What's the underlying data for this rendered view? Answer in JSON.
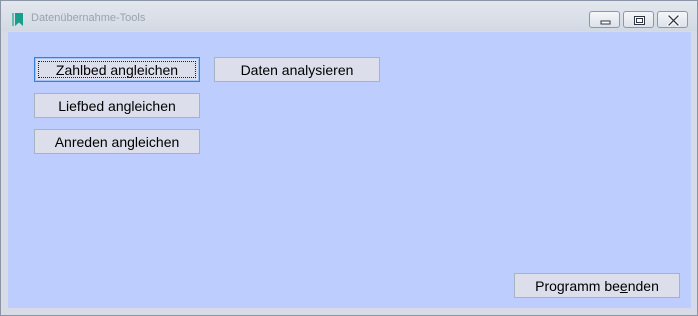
{
  "window": {
    "title": "Datenübernahme-Tools",
    "controls": {
      "minimize": "minimize-icon",
      "maximize": "maximize-icon",
      "close": "close-icon"
    }
  },
  "buttons": {
    "zahlbed": "Zahlbed angleichen",
    "liefbed": "Liefbed angleichen",
    "anreden": "Anreden angleichen",
    "analysieren": "Daten analysieren",
    "beenden_pre": "Programm be",
    "beenden_accel": "e",
    "beenden_post": "nden"
  },
  "colors": {
    "client_background": "#bdcdfd",
    "button_face": "#dcdfeb",
    "focus_border": "#3c7fd6",
    "app_icon": "#1a9e8c"
  }
}
